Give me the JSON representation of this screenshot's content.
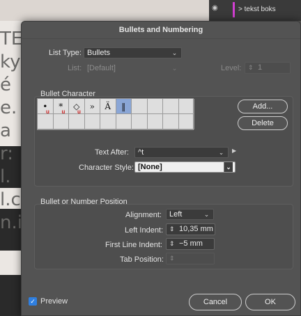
{
  "background": {
    "letters": [
      "TE",
      "ky",
      "é",
      "e.",
      "a",
      "r:",
      "l.",
      "l.c",
      "n.i"
    ],
    "layers_panel": {
      "eye_icon": "eye-icon",
      "layer_color": "#d23fd2",
      "layer_name": "> tekst boks"
    }
  },
  "dialog": {
    "title": "Bullets and Numbering",
    "list_type": {
      "label": "List Type:",
      "value": "Bullets"
    },
    "list": {
      "label": "List:",
      "value": "[Default]"
    },
    "level": {
      "label": "Level:",
      "value": "1"
    },
    "bullet_character": {
      "heading": "Bullet Character",
      "glyphs": [
        {
          "char": "•",
          "unicode_marker": "u",
          "selected": false
        },
        {
          "char": "*",
          "unicode_marker": "u",
          "selected": false
        },
        {
          "char": "◇",
          "unicode_marker": "u",
          "selected": false
        },
        {
          "char": "»",
          "unicode_marker": "",
          "selected": false
        },
        {
          "char": "Ä",
          "unicode_marker": "",
          "selected": false
        },
        {
          "char": "‖",
          "unicode_marker": "",
          "selected": true
        },
        {
          "char": "",
          "unicode_marker": "",
          "selected": false
        },
        {
          "char": "",
          "unicode_marker": "",
          "selected": false
        },
        {
          "char": "",
          "unicode_marker": "",
          "selected": false
        },
        {
          "char": "",
          "unicode_marker": "",
          "selected": false
        },
        {
          "char": "",
          "unicode_marker": "",
          "selected": false
        },
        {
          "char": "",
          "unicode_marker": "",
          "selected": false
        },
        {
          "char": "",
          "unicode_marker": "",
          "selected": false
        },
        {
          "char": "",
          "unicode_marker": "",
          "selected": false
        },
        {
          "char": "",
          "unicode_marker": "",
          "selected": false
        },
        {
          "char": "",
          "unicode_marker": "",
          "selected": false
        },
        {
          "char": "",
          "unicode_marker": "",
          "selected": false
        },
        {
          "char": "",
          "unicode_marker": "",
          "selected": false
        },
        {
          "char": "",
          "unicode_marker": "",
          "selected": false
        },
        {
          "char": "",
          "unicode_marker": "",
          "selected": false
        }
      ],
      "add_label": "Add...",
      "delete_label": "Delete"
    },
    "text_after": {
      "label": "Text After:",
      "value": "^t"
    },
    "character_style": {
      "label": "Character Style:",
      "value": "[None]"
    },
    "position": {
      "heading": "Bullet or Number Position",
      "alignment": {
        "label": "Alignment:",
        "value": "Left"
      },
      "left_indent": {
        "label": "Left Indent:",
        "value": "10,35 mm"
      },
      "first_line_indent": {
        "label": "First Line Indent:",
        "value": "−5 mm"
      },
      "tab_position": {
        "label": "Tab Position:",
        "value": ""
      }
    },
    "preview": {
      "label": "Preview",
      "checked": true
    },
    "cancel_label": "Cancel",
    "ok_label": "OK"
  },
  "colors": {
    "dialog_bg": "#535353",
    "selected_glyph": "#8aa6d6",
    "checkbox": "#2f7fe0"
  }
}
